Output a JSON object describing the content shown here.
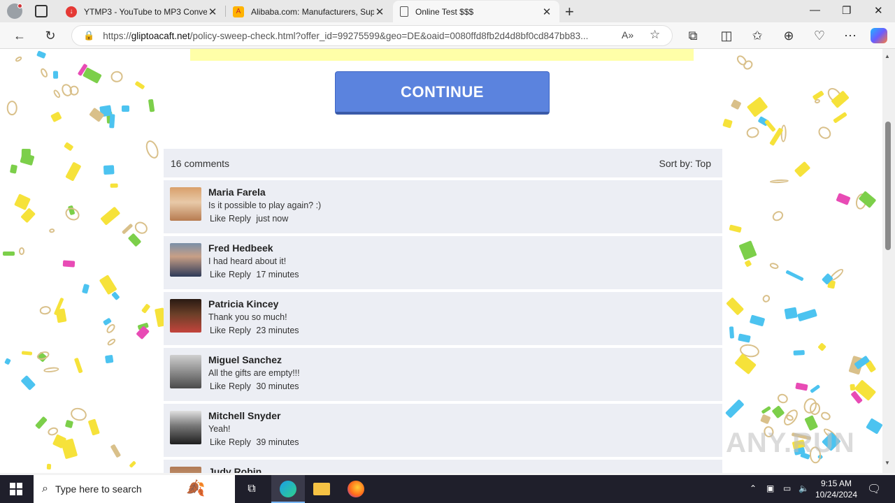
{
  "browser": {
    "tabs": [
      {
        "title": "YTMP3 - YouTube to MP3 Converter",
        "favicon": "download-red-icon",
        "active": false
      },
      {
        "title": "Alibaba.com: Manufacturers, Suppliers",
        "favicon": "alibaba-icon",
        "active": false
      },
      {
        "title": "Online Test $$$",
        "favicon": "page-icon",
        "active": true
      }
    ],
    "url_prefix": "https://",
    "url_domain": "gliptoacaft.net",
    "url_rest": "/policy-sweep-check.html?offer_id=99275599&geo=DE&oaid=0080ffd8fb2d4d8bf0cd847bb83..."
  },
  "page": {
    "continue_label": "CONTINUE",
    "comments_count": "16 comments",
    "sort_label": "Sort by:",
    "sort_value": "Top",
    "like_label": "Like",
    "reply_label": "Reply",
    "comments": [
      {
        "name": "Maria Farela",
        "text": "Is it possible to play again? :)",
        "time": "just now"
      },
      {
        "name": "Fred Hedbeek",
        "text": "I had heard about it!",
        "time": "17 minutes"
      },
      {
        "name": "Patricia Kincey",
        "text": "Thank you so much!",
        "time": "23 minutes"
      },
      {
        "name": "Miguel Sanchez",
        "text": "All the gifts are empty!!!",
        "time": "30 minutes"
      },
      {
        "name": "Mitchell Snyder",
        "text": "Yeah!",
        "time": "39 minutes"
      },
      {
        "name": "Judy Robin",
        "text": "",
        "time": ""
      }
    ]
  },
  "watermark": "ANY.RUN",
  "taskbar": {
    "search_placeholder": "Type here to search",
    "time": "9:15 AM",
    "date": "10/24/2024"
  },
  "colors": {
    "continue_button": "#5b83de",
    "comment_bg": "#eceef4",
    "yellow_strip": "#ffffa8"
  }
}
